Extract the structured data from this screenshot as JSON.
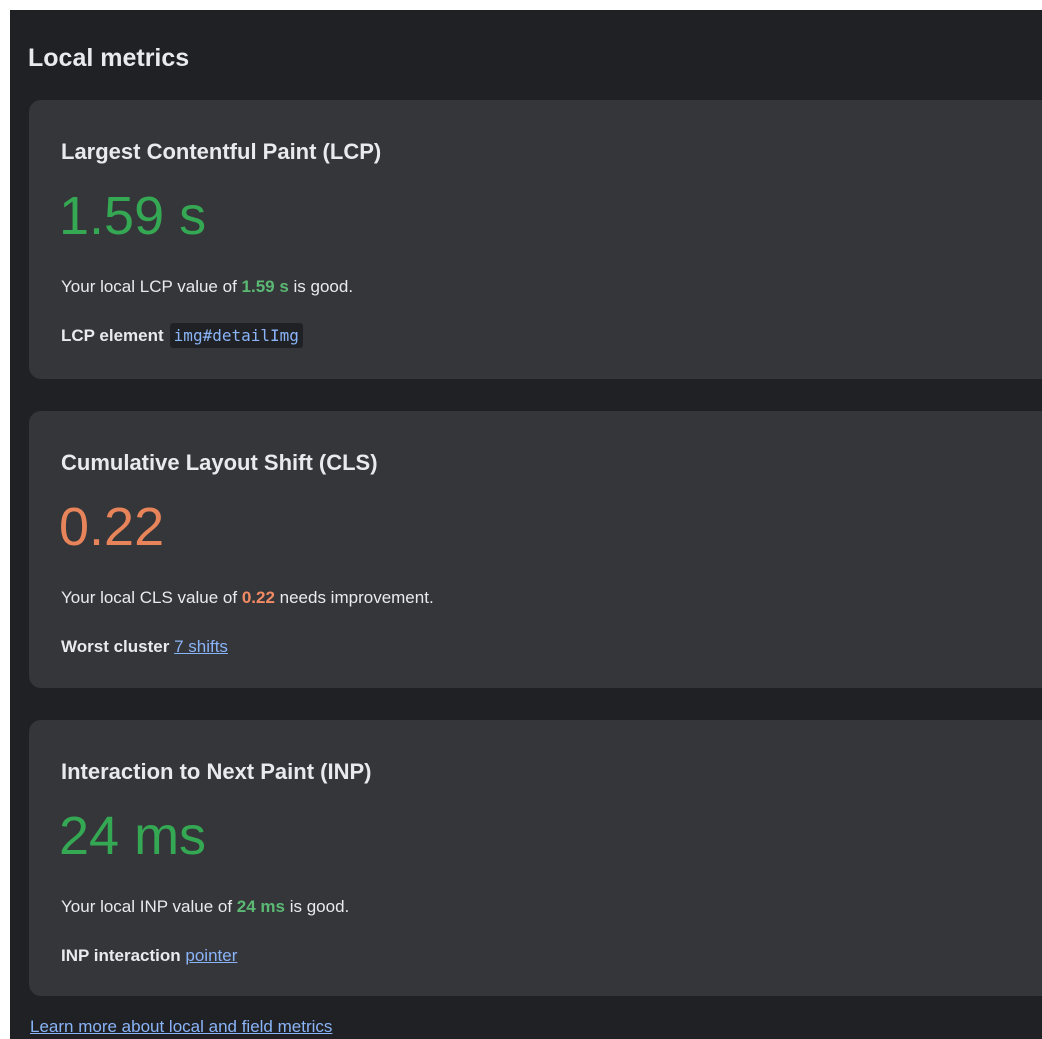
{
  "panel": {
    "title": "Local metrics"
  },
  "metrics": [
    {
      "title": "Largest Contentful Paint (LCP)",
      "value": "1.59 s",
      "status": "good",
      "desc_prefix": "Your local LCP value of ",
      "desc_value": "1.59 s",
      "desc_suffix": " is good.",
      "detail_label": "LCP element",
      "detail_value": "img#detailImg"
    },
    {
      "title": "Cumulative Layout Shift (CLS)",
      "value": "0.22",
      "status": "needs-improvement",
      "desc_prefix": "Your local CLS value of ",
      "desc_value": "0.22",
      "desc_suffix": " needs improvement.",
      "detail_label": "Worst cluster",
      "detail_value": "7 shifts"
    },
    {
      "title": "Interaction to Next Paint (INP)",
      "value": "24 ms",
      "status": "good",
      "desc_prefix": "Your local INP value of ",
      "desc_value": "24 ms",
      "desc_suffix": " is good.",
      "detail_label": "INP interaction",
      "detail_value": "pointer"
    }
  ],
  "footer": {
    "learn_more": "Learn more about local and field metrics"
  },
  "colors": {
    "panel_bg": "#202124",
    "card_bg": "#35363a",
    "good": "#34a853",
    "needs_improvement": "#e8845a",
    "link": "#8ab4f8"
  }
}
